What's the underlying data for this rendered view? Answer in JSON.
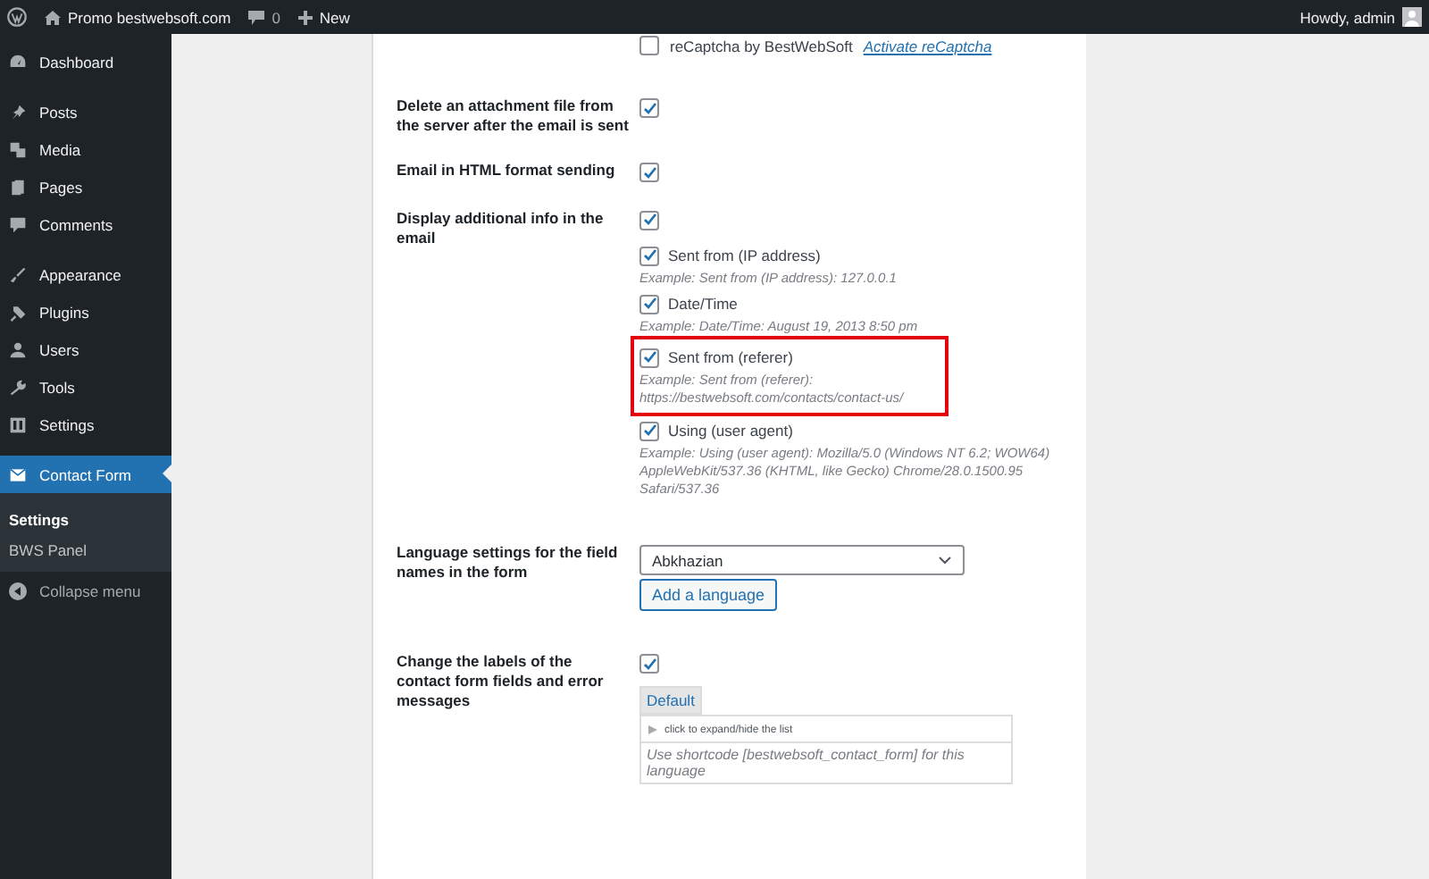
{
  "admin_bar": {
    "site": "Promo bestwebsoft.com",
    "comments": "0",
    "new": "New",
    "greeting": "Howdy, admin"
  },
  "sidebar": {
    "groups": [
      [
        {
          "label": "Dashboard",
          "selected": false
        }
      ],
      [
        {
          "label": "Posts",
          "selected": false
        },
        {
          "label": "Media",
          "selected": false
        },
        {
          "label": "Pages",
          "selected": false
        },
        {
          "label": "Comments",
          "selected": false
        }
      ],
      [
        {
          "label": "Appearance",
          "selected": false
        },
        {
          "label": "Plugins",
          "selected": false
        },
        {
          "label": "Users",
          "selected": false
        },
        {
          "label": "Tools",
          "selected": false
        },
        {
          "label": "Settings",
          "selected": false
        }
      ],
      [
        {
          "label": "Contact Form",
          "selected": true
        }
      ]
    ],
    "submenu": [
      {
        "label": "Settings",
        "selected": true
      },
      {
        "label": "BWS Panel",
        "selected": false
      }
    ],
    "collapse": "Collapse menu"
  },
  "recaptcha": {
    "label": "reCaptcha by BestWebSoft",
    "link": "Activate reCaptcha",
    "checked": false
  },
  "rows": [
    {
      "kind": "checkbox",
      "label": "Delete an attachment file from the server after the email is sent",
      "checked": true
    },
    {
      "kind": "checkbox",
      "label": "Email in HTML format sending",
      "checked": true
    },
    {
      "kind": "info",
      "label": "Display additional info in the email",
      "checked": true,
      "options": [
        {
          "label": "Sent from (IP address)",
          "checked": true,
          "example": "Example: Sent from (IP address): 127.0.0.1",
          "highlighted": false
        },
        {
          "label": "Date/Time",
          "checked": true,
          "example": "Example: Date/Time: August 19, 2013 8:50 pm",
          "highlighted": false
        },
        {
          "label": "Sent from (referer)",
          "checked": true,
          "example": "Example: Sent from (referer): https://bestwebsoft.com/contacts/contact-us/",
          "highlighted": true
        },
        {
          "label": "Using (user agent)",
          "checked": true,
          "example": "Example: Using (user agent): Mozilla/5.0 (Windows NT 6.2; WOW64) AppleWebKit/537.36 (KHTML, like Gecko) Chrome/28.0.1500.95 Safari/537.36",
          "highlighted": false
        }
      ]
    },
    {
      "kind": "language",
      "label": "Language settings for the field names in the form",
      "value": "Abkhazian",
      "button": "Add a language"
    },
    {
      "kind": "labels",
      "label": "Change the labels of the contact form fields and error messages",
      "checked": true,
      "tab": "Default",
      "toggle": "click to expand/hide the list",
      "note": "Use shortcode [bestwebsoft_contact_form] for this language"
    }
  ]
}
